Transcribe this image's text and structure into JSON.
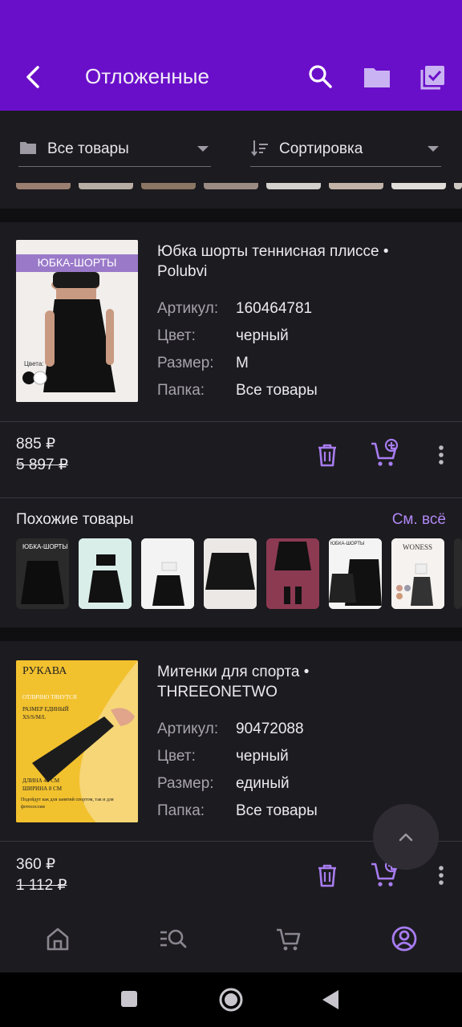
{
  "header": {
    "title": "Отложенные"
  },
  "filters": {
    "folder_label": "Все товары",
    "sort_label": "Сортировка"
  },
  "products": [
    {
      "image_text": "ЮБКА-ШОРТЫ",
      "image_colors_label": "Цвета:",
      "name": "Юбка шорты теннисная плиссе • Polubvi",
      "attrs": [
        {
          "key": "Артикул:",
          "value": "160464781"
        },
        {
          "key": "Цвет:",
          "value": "черный"
        },
        {
          "key": "Размер:",
          "value": "M"
        },
        {
          "key": "Папка:",
          "value": "Все товары"
        }
      ],
      "price": "885 ₽",
      "old_price": "5 897 ₽"
    },
    {
      "image_text": "РУКАВА",
      "image_lines": [
        "ОТЛИЧНО ТЯНУТСЯ",
        "РАЗМЕР ЕДИНЫЙ",
        "XS/S/M/L",
        "ДЛИНА 40 СМ",
        "ШИРИНА 8 СМ",
        "Подойдут как для занятий спортом, так и для фотосессии"
      ],
      "name": "Митенки для спорта • THREEONETWO",
      "attrs": [
        {
          "key": "Артикул:",
          "value": "90472088"
        },
        {
          "key": "Цвет:",
          "value": "черный"
        },
        {
          "key": "Размер:",
          "value": "единый"
        },
        {
          "key": "Папка:",
          "value": "Все товары"
        }
      ],
      "price": "360 ₽",
      "old_price": "1 112 ₽"
    }
  ],
  "similar": {
    "title": "Похожие товары",
    "see_all": "См. всё",
    "thumb_texts": [
      "ЮБКА-ШОРТЫ",
      "ЮБКА-ШОРТЫ",
      "WONESS"
    ]
  },
  "colors": {
    "header": "#6a0fc9",
    "accent": "#b088f5",
    "background": "#1c1b1f"
  },
  "icons": [
    "back-arrow-icon",
    "search-icon",
    "folder-icon",
    "checklist-icon",
    "trash-icon",
    "add-to-cart-icon",
    "more-icon",
    "home-icon",
    "catalog-search-icon",
    "cart-icon",
    "profile-icon",
    "chevron-up-icon"
  ]
}
